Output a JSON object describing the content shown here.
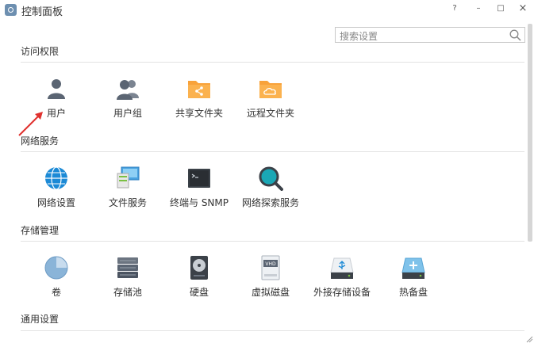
{
  "window": {
    "title": "控制面板",
    "help_label": "?",
    "minimize_label": "–",
    "maximize_label": "□",
    "close_label": "×"
  },
  "search": {
    "placeholder": "搜索设置",
    "value": ""
  },
  "sections": [
    {
      "title": "访问权限",
      "items": [
        {
          "label": "用户",
          "icon": "user-icon"
        },
        {
          "label": "用户组",
          "icon": "user-group-icon"
        },
        {
          "label": "共享文件夹",
          "icon": "shared-folder-icon"
        },
        {
          "label": "远程文件夹",
          "icon": "remote-folder-icon"
        }
      ]
    },
    {
      "title": "网络服务",
      "items": [
        {
          "label": "网络设置",
          "icon": "globe-icon"
        },
        {
          "label": "文件服务",
          "icon": "file-service-icon"
        },
        {
          "label": "终端与 SNMP",
          "icon": "terminal-icon"
        },
        {
          "label": "网络探索服务",
          "icon": "network-discovery-icon"
        }
      ]
    },
    {
      "title": "存储管理",
      "items": [
        {
          "label": "卷",
          "icon": "volume-pie-icon"
        },
        {
          "label": "存储池",
          "icon": "storage-pool-icon"
        },
        {
          "label": "硬盘",
          "icon": "hard-disk-icon"
        },
        {
          "label": "虚拟磁盘",
          "icon": "vhd-icon"
        },
        {
          "label": "外接存储设备",
          "icon": "usb-drive-icon"
        },
        {
          "label": "热备盘",
          "icon": "hot-spare-icon"
        }
      ]
    },
    {
      "title": "通用设置",
      "items": []
    }
  ],
  "colors": {
    "folder": "#f8a23a",
    "accent_blue": "#1c8ad6",
    "arrow": "#e0312e",
    "grey_icon": "#5b6573"
  }
}
